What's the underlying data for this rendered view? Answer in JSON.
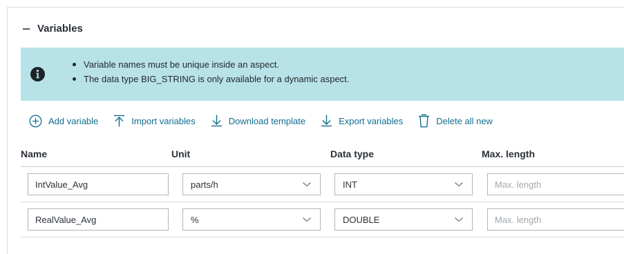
{
  "section": {
    "title": "Variables",
    "collapse_icon": "minus-icon"
  },
  "info": {
    "icon": "info-circle-icon",
    "items": [
      "Variable names must be unique inside an aspect.",
      "The data type BIG_STRING is only available for a dynamic aspect."
    ]
  },
  "toolbar": {
    "add_label": "Add variable",
    "import_label": "Import variables",
    "download_label": "Download template",
    "export_label": "Export variables",
    "delete_label": "Delete all new"
  },
  "table": {
    "columns": [
      "Name",
      "Unit",
      "Data type",
      "Max. length"
    ],
    "rows": [
      {
        "name": "IntValue_Avg",
        "unit": "parts/h",
        "data_type": "INT",
        "max_length": "",
        "max_length_placeholder": "Max. length"
      },
      {
        "name": "RealValue_Avg",
        "unit": "%",
        "data_type": "DOUBLE",
        "max_length": "",
        "max_length_placeholder": "Max. length"
      }
    ]
  },
  "colors": {
    "accent": "#0e6e8f",
    "info_background": "#b7e2e8",
    "border": "#aeb5bc"
  }
}
